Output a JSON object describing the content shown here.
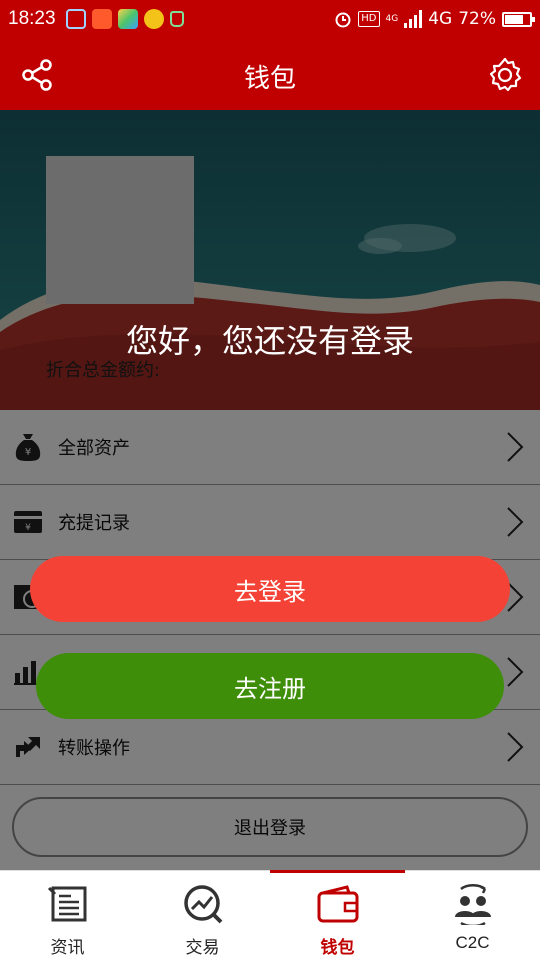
{
  "status_bar": {
    "time": "18:23",
    "network_small": "4G",
    "network": "4G",
    "battery_pct": "72%",
    "hd_label": "HD"
  },
  "header": {
    "title": "钱包",
    "left_icon": "share-icon",
    "right_icon": "settings-icon"
  },
  "wallet": {
    "total_label": "折合总金额约:"
  },
  "list": [
    {
      "label": "全部资产",
      "icon": "money-bag-icon"
    },
    {
      "label": "充提记录",
      "icon": "card-icon"
    },
    {
      "label": "",
      "icon": "exchange-icon"
    },
    {
      "label": "",
      "icon": "bar-chart-icon"
    },
    {
      "label": "转账操作",
      "icon": "transfer-icon"
    }
  ],
  "logout_label": "退出登录",
  "dialog": {
    "greeting": "您好，您还没有登录",
    "login_label": "去登录",
    "register_label": "去注册"
  },
  "tabs": [
    {
      "label": "资讯",
      "icon": "news-icon",
      "active": false
    },
    {
      "label": "交易",
      "icon": "trade-icon",
      "active": false
    },
    {
      "label": "钱包",
      "icon": "wallet-icon",
      "active": true
    },
    {
      "label": "C2C",
      "icon": "c2c-icon",
      "active": false
    }
  ],
  "colors": {
    "brand_red": "#c00000",
    "login_button": "#f44336",
    "register_button": "#3e8e0a"
  }
}
